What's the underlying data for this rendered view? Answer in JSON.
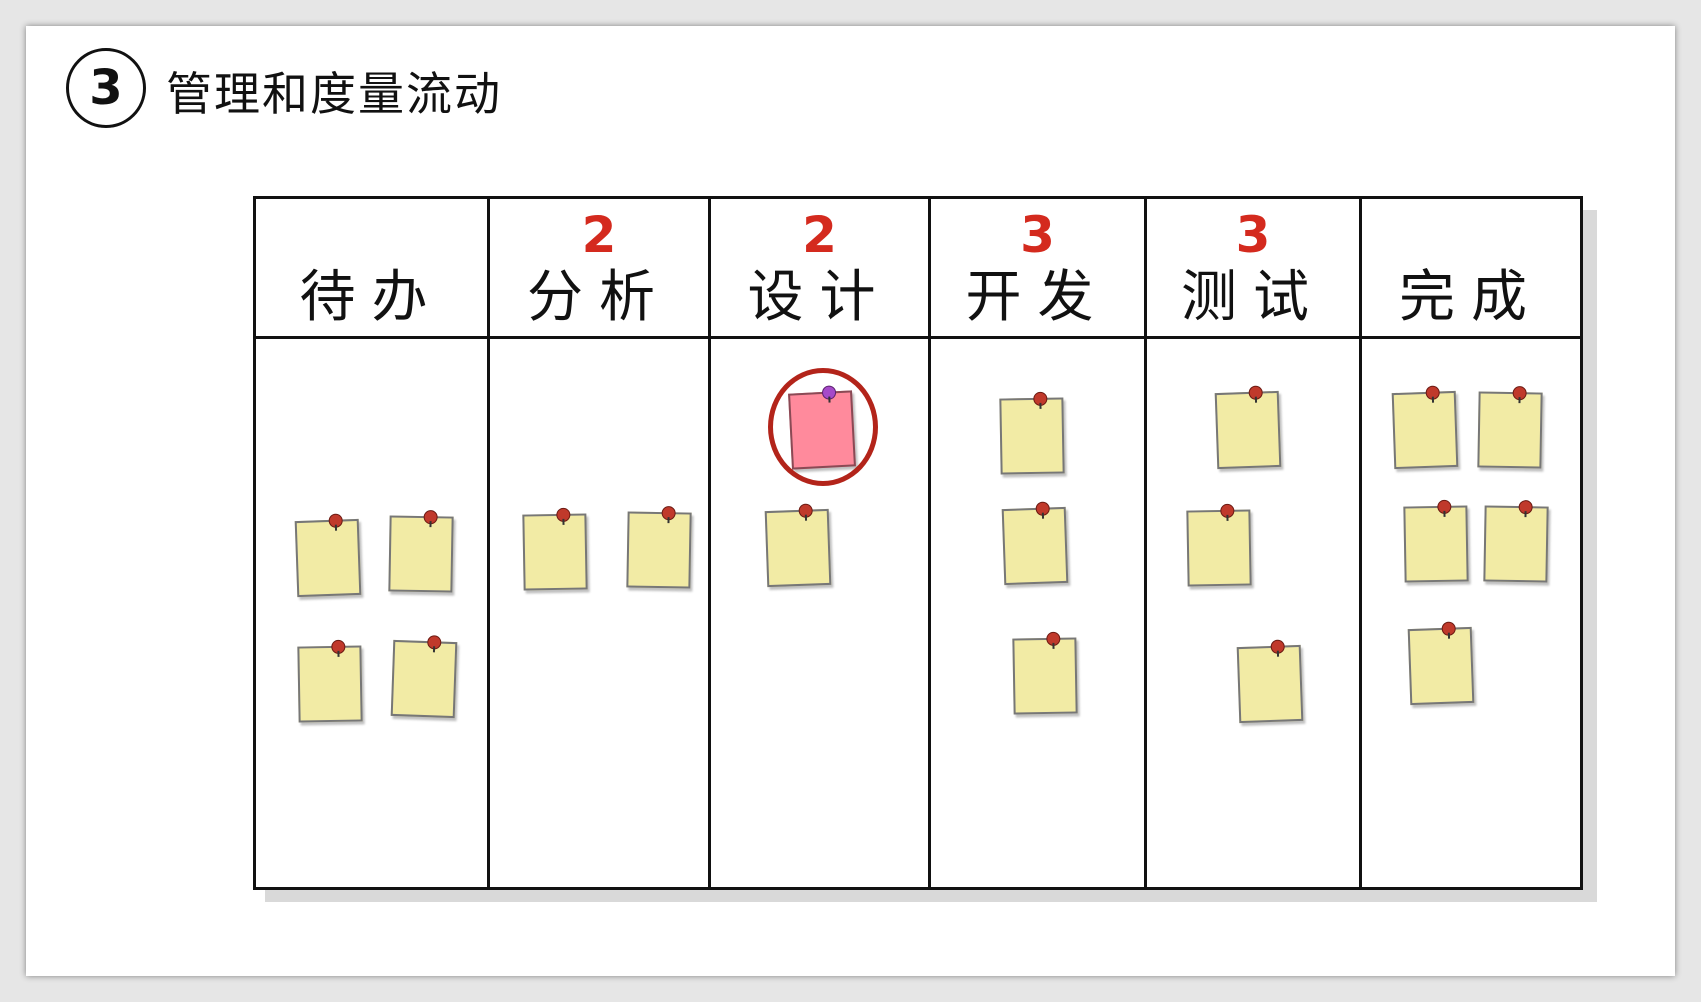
{
  "step": {
    "number": "3",
    "title": "管理和度量流动"
  },
  "board": {
    "columns": [
      {
        "name": "待办",
        "wip_limit": ""
      },
      {
        "name": "分析",
        "wip_limit": "2"
      },
      {
        "name": "设计",
        "wip_limit": "2"
      },
      {
        "name": "开发",
        "wip_limit": "3"
      },
      {
        "name": "测试",
        "wip_limit": "3"
      },
      {
        "name": "完成",
        "wip_limit": ""
      }
    ],
    "card_counts": [
      4,
      2,
      2,
      3,
      3,
      5
    ],
    "highlighted_card": {
      "column": "设计",
      "color": "#ff8a9c"
    }
  },
  "colors": {
    "wip_limit": "#d42a1e",
    "sticky_note": "#f2eba5",
    "highlight_ring": "#b3241a"
  }
}
